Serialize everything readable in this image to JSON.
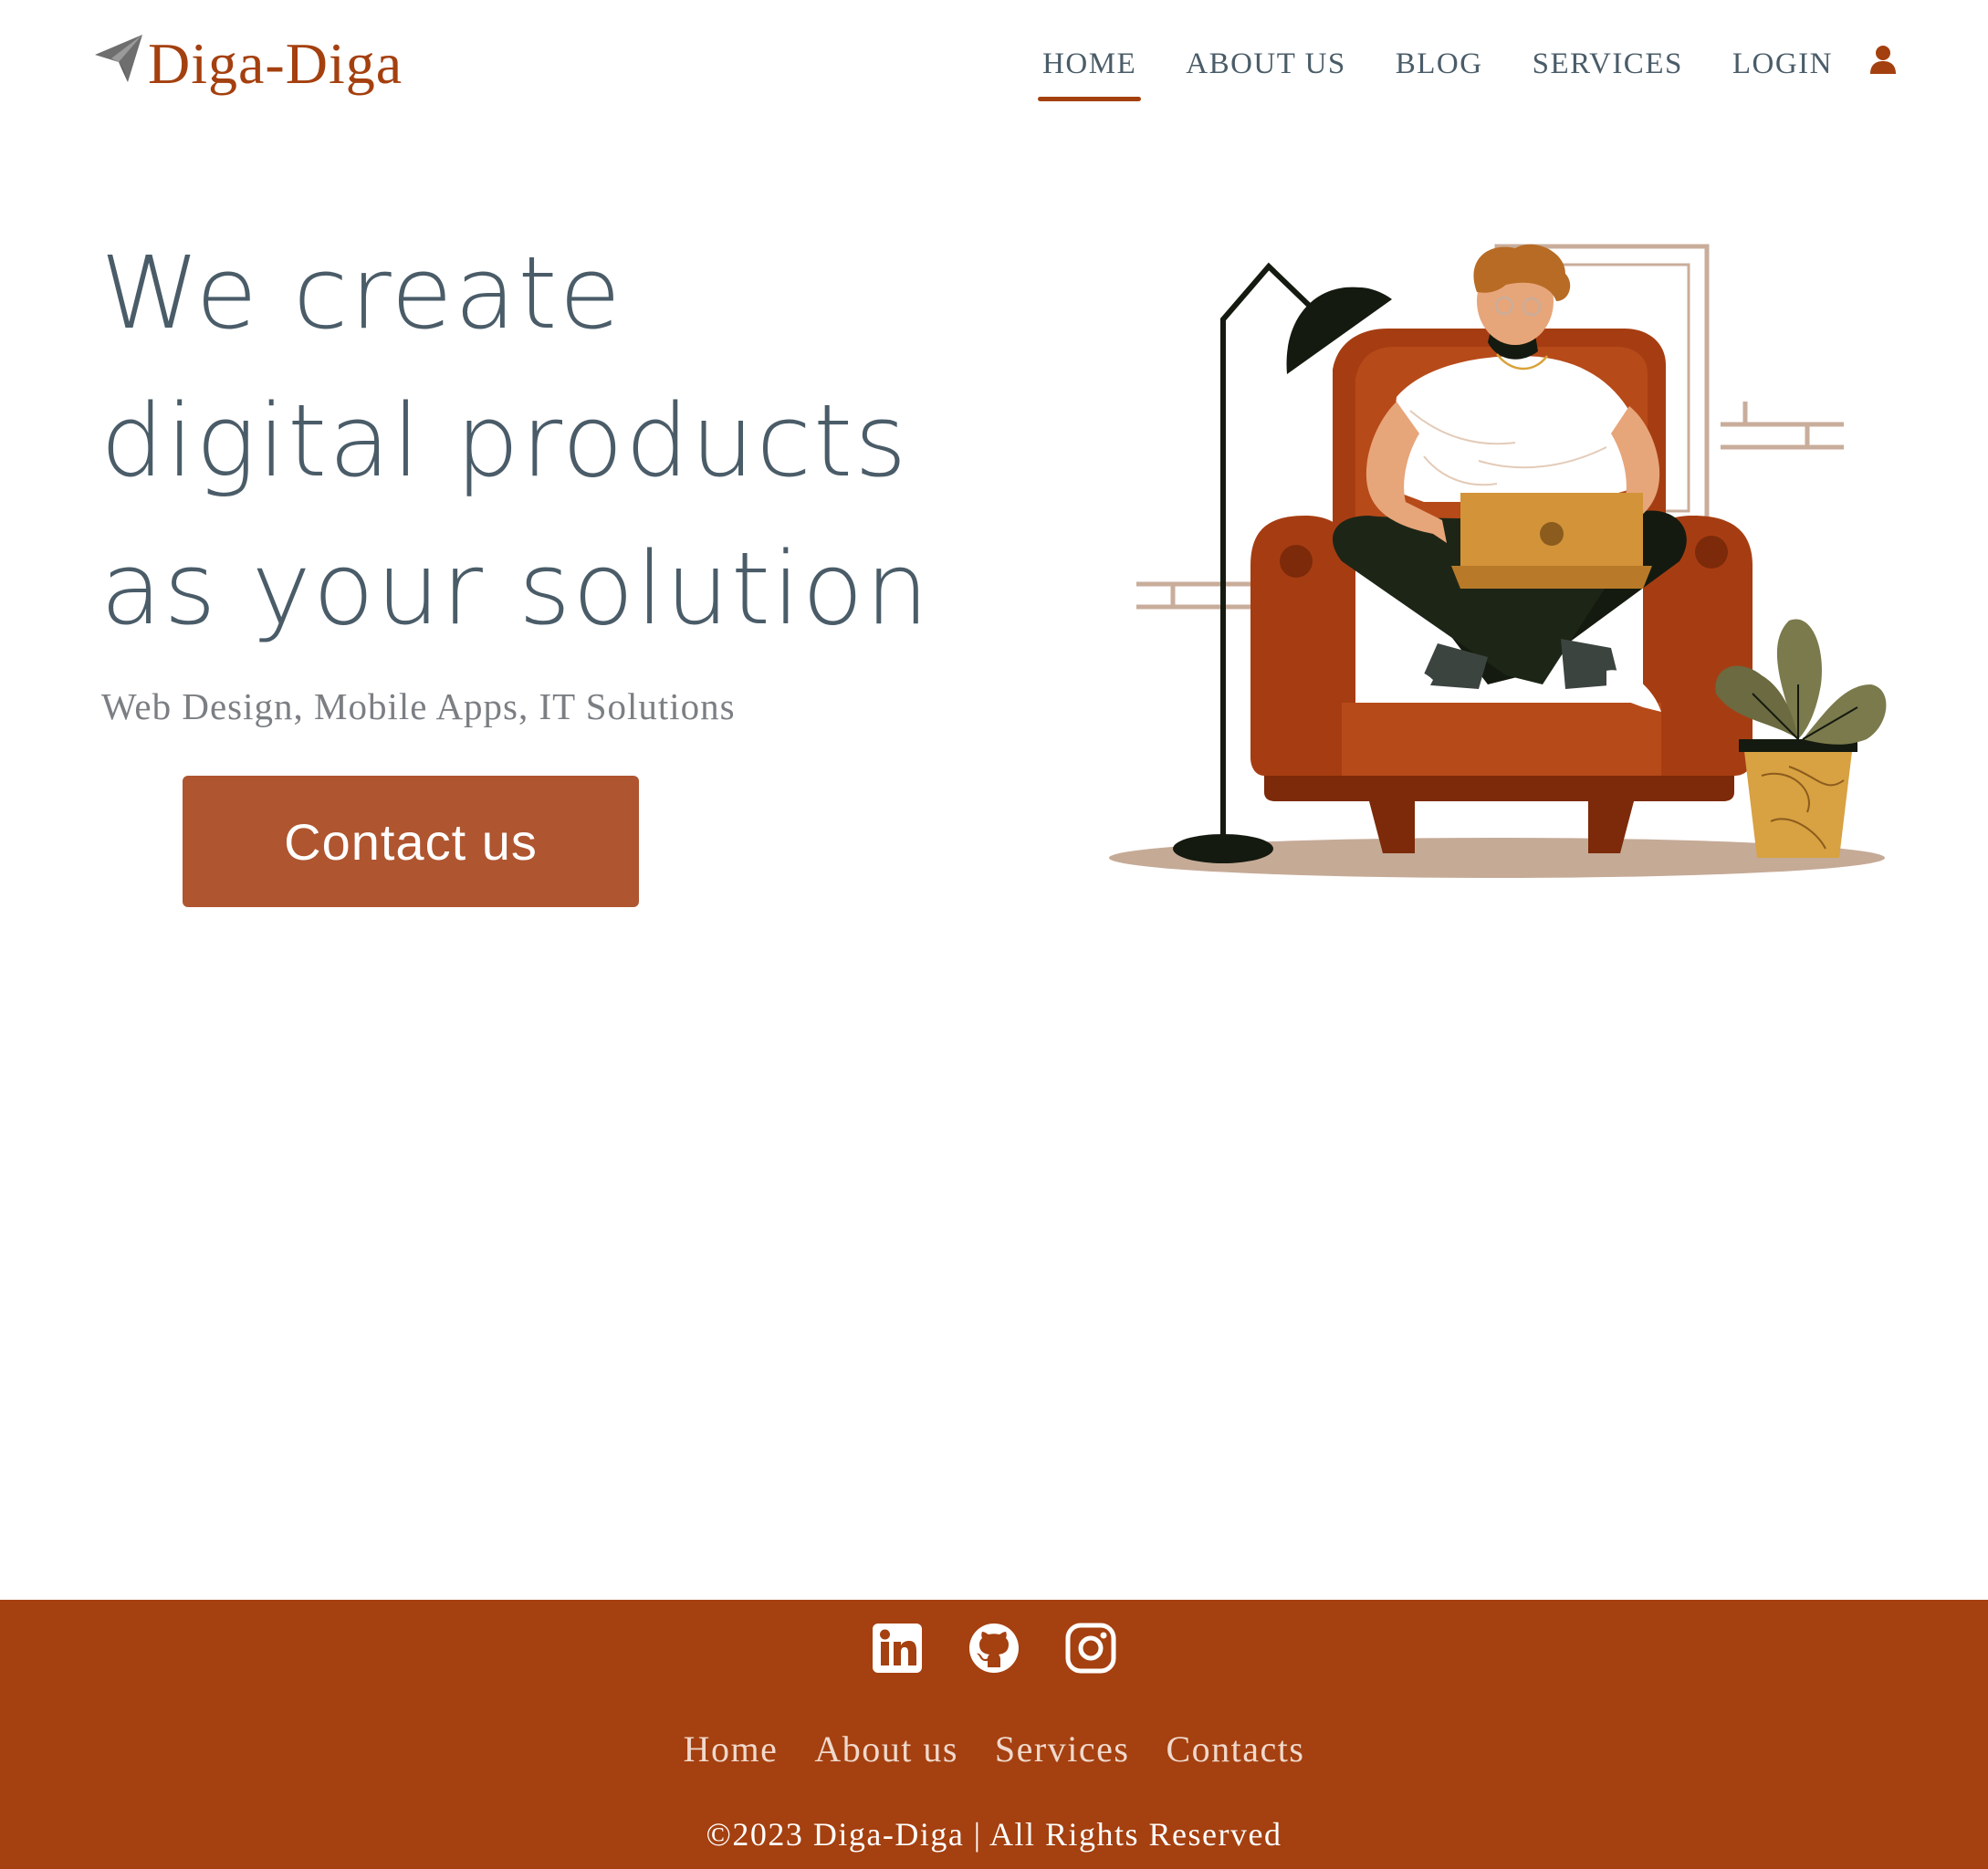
{
  "brand": {
    "name": "Diga-Diga",
    "logo_icon": "paper-plane-icon",
    "color": "#a4400f"
  },
  "nav": {
    "items": [
      {
        "label": "HOME",
        "active": true
      },
      {
        "label": "ABOUT US",
        "active": false
      },
      {
        "label": "BLOG",
        "active": false
      },
      {
        "label": "SERVICES",
        "active": false
      },
      {
        "label": "LOGIN",
        "active": false
      }
    ],
    "user_icon": "user-icon"
  },
  "hero": {
    "title_lines": [
      "We create",
      "digital products",
      "as your solution"
    ],
    "subtitle": "Web Design, Mobile Apps, IT Solutions",
    "cta_label": "Contact us",
    "illustration": "man-with-laptop-in-armchair"
  },
  "footer": {
    "socials": [
      "linkedin-icon",
      "github-icon",
      "instagram-icon"
    ],
    "links": [
      "Home",
      "About us",
      "Services",
      "Contacts"
    ],
    "copyright": "©2023 Diga-Diga | All Rights Reserved",
    "background": "#a54010"
  },
  "colors": {
    "text_primary": "#4a5c68",
    "accent": "#a4400f",
    "button": "#af5530"
  }
}
